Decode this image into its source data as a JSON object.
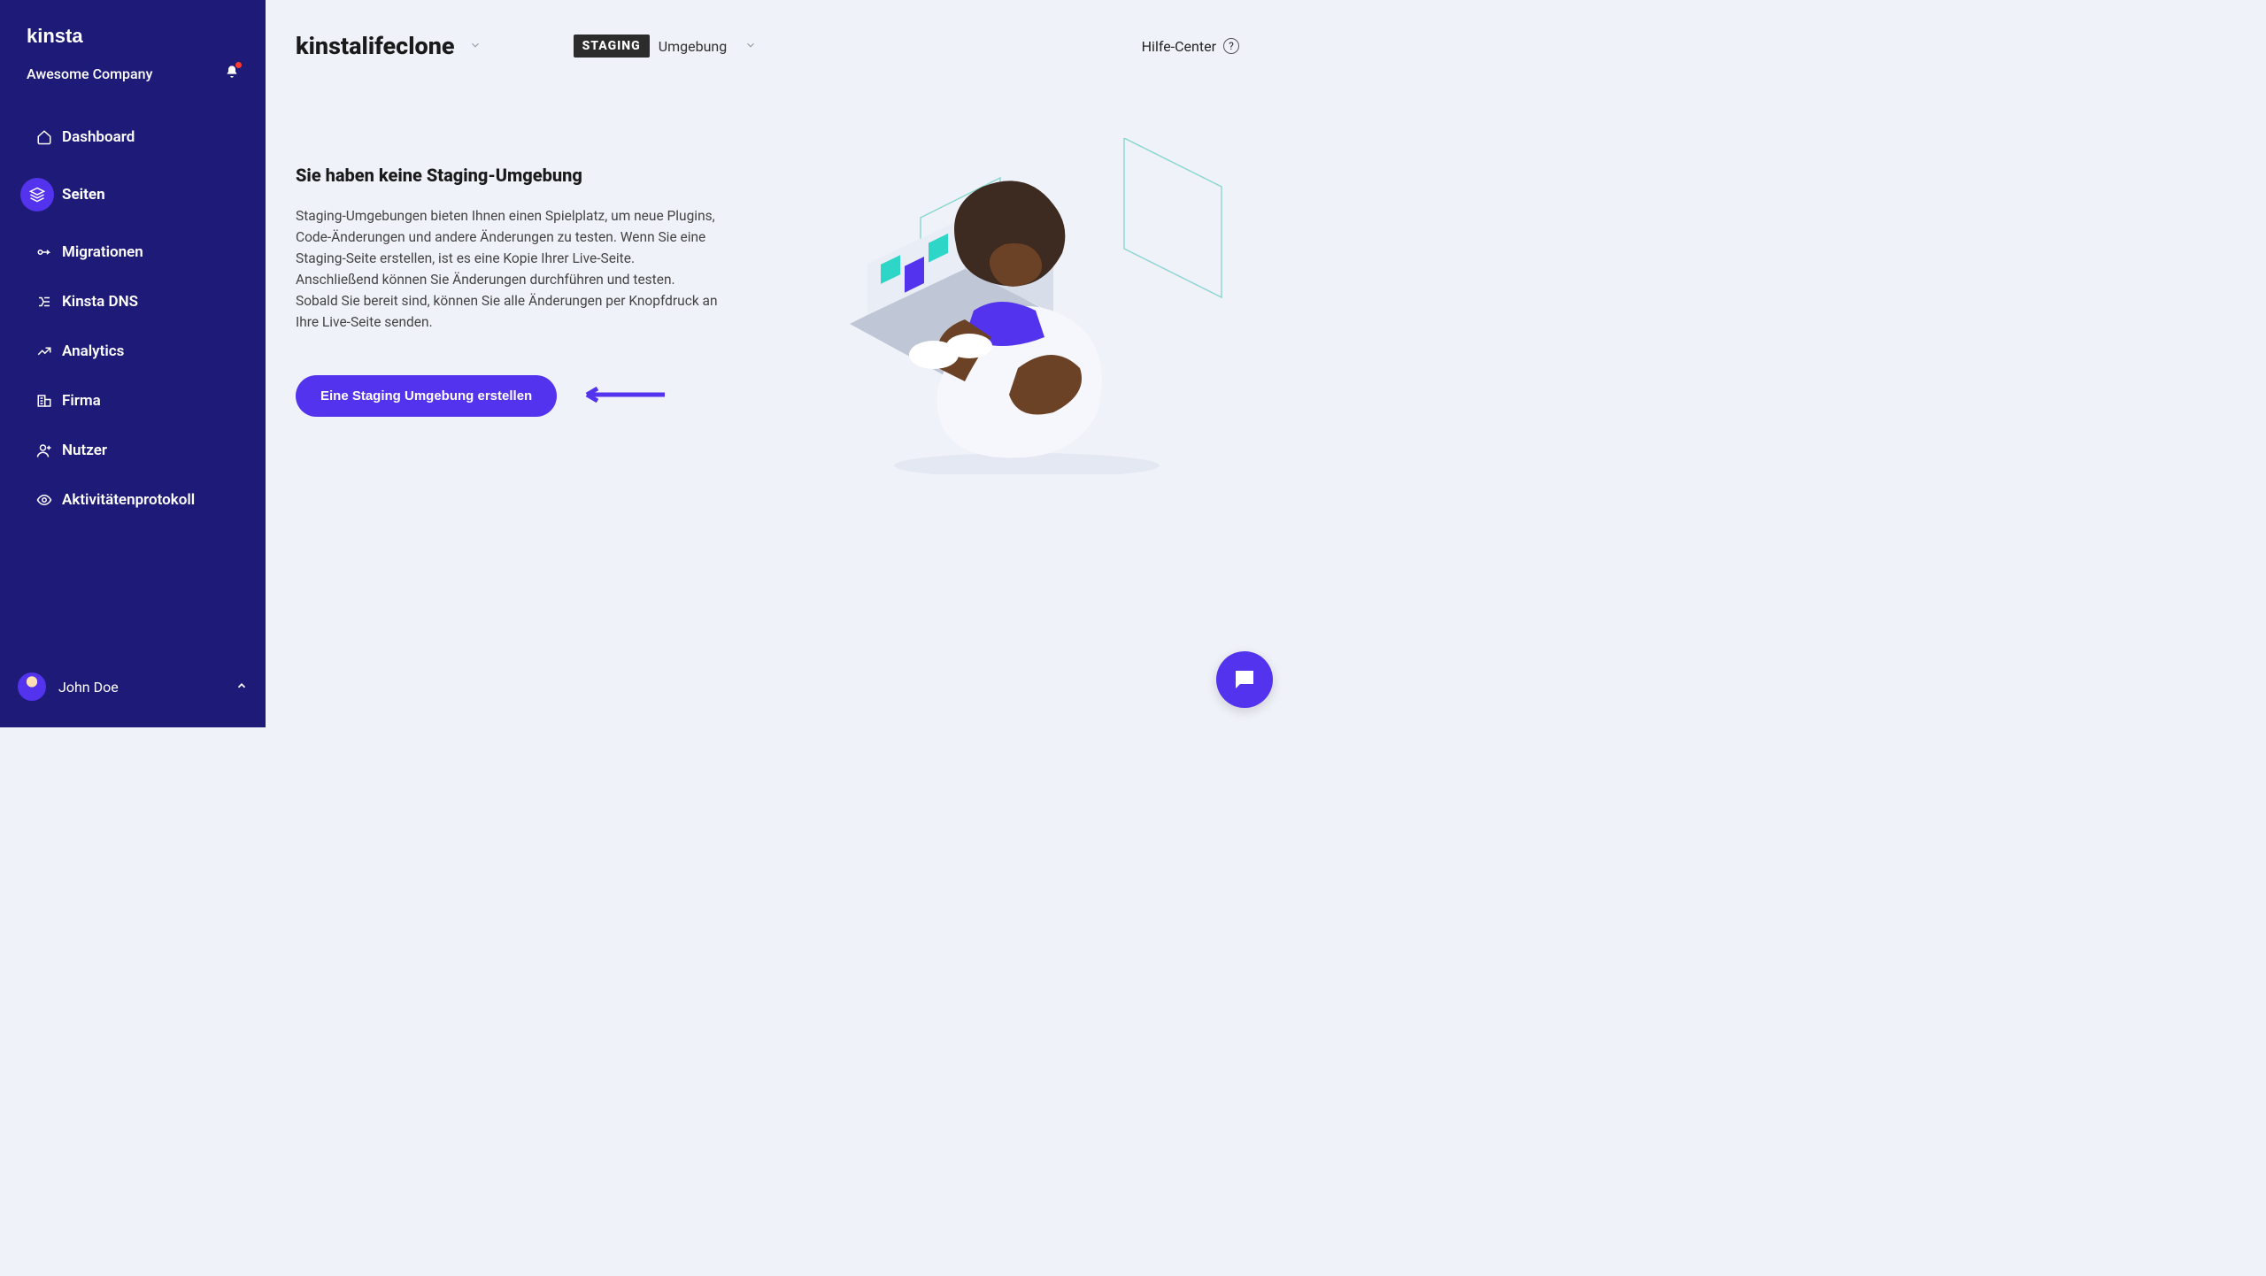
{
  "brand": {
    "logo_text": "KINSTA"
  },
  "company": "Awesome Company",
  "nav": {
    "items": [
      {
        "label": "Dashboard",
        "icon": "home"
      },
      {
        "label": "Seiten",
        "icon": "layers",
        "active": true
      },
      {
        "label": "Migrationen",
        "icon": "migrate"
      },
      {
        "label": "Kinsta DNS",
        "icon": "dns"
      },
      {
        "label": "Analytics",
        "icon": "analytics"
      },
      {
        "label": "Firma",
        "icon": "company"
      },
      {
        "label": "Nutzer",
        "icon": "user"
      },
      {
        "label": "Aktivitätenprotokoll",
        "icon": "eye"
      }
    ]
  },
  "user": {
    "name": "John Doe"
  },
  "header": {
    "site_name": "kinstalifeclone",
    "env_badge": "STAGING",
    "env_label": "Umgebung",
    "help_label": "Hilfe-Center"
  },
  "main": {
    "heading": "Sie haben keine Staging-Umgebung",
    "description": "Staging-Umgebungen bieten Ihnen einen Spielplatz, um neue Plugins, Code-Änderungen und andere Änderungen zu testen. Wenn Sie eine Staging-Seite erstellen, ist es eine Kopie Ihrer Live-Seite. Anschließend können Sie Änderungen durchführen und testen. Sobald Sie bereit sind, können Sie alle Änderungen per Knopfdruck an Ihre Live-Seite senden.",
    "cta_label": "Eine Staging Umgebung erstellen"
  },
  "colors": {
    "accent": "#5333ed",
    "sidebar": "#1e1a78"
  }
}
